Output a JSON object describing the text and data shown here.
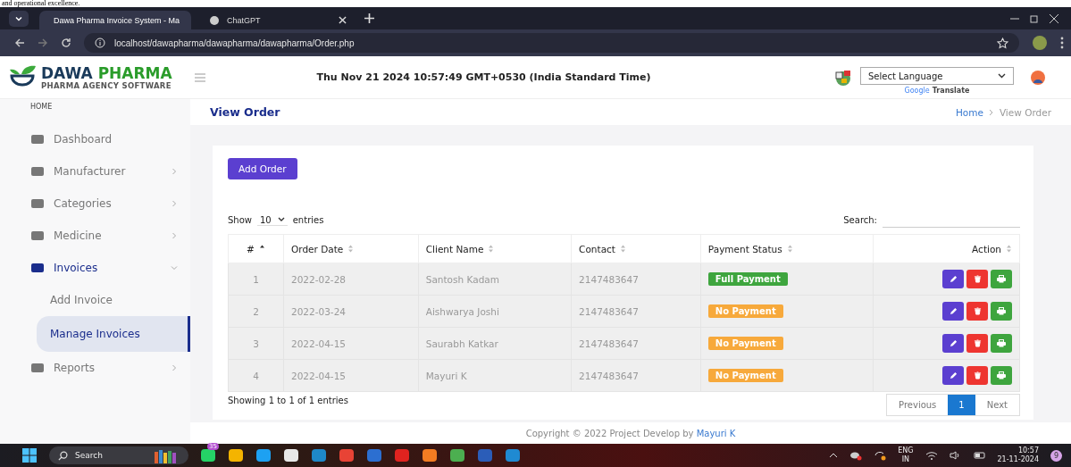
{
  "caption_text": "and operational excellence.",
  "browser": {
    "tabs": [
      {
        "title": "Dawa Pharma Invoice System - Ma",
        "selected": true
      },
      {
        "title": "ChatGPT",
        "selected": false
      }
    ],
    "url": "localhost/dawapharma/dawapharma/dawapharma/Order.php"
  },
  "header": {
    "logo_word_1": "DAWA",
    "logo_word_2": "PHARMA",
    "logo_subtitle": "PHARMA AGENCY SOFTWARE",
    "datetime": "Thu Nov 21 2024 10:57:49 GMT+0530 (India Standard Time)",
    "language_select": "Select Language",
    "translate_brand": "Google",
    "translate_label": "Translate"
  },
  "sidebar": {
    "section": "HOME",
    "items": [
      {
        "label": "Dashboard",
        "kind": "link",
        "active": false
      },
      {
        "label": "Manufacturer",
        "kind": "menu",
        "active": false,
        "expanded": false
      },
      {
        "label": "Categories",
        "kind": "menu",
        "active": false,
        "expanded": false
      },
      {
        "label": "Medicine",
        "kind": "menu",
        "active": false,
        "expanded": false
      },
      {
        "label": "Invoices",
        "kind": "menu",
        "active": true,
        "expanded": true,
        "children": [
          {
            "label": "Add Invoice",
            "selected": false
          },
          {
            "label": "Manage Invoices",
            "selected": true
          }
        ]
      },
      {
        "label": "Reports",
        "kind": "menu",
        "active": false,
        "expanded": false
      }
    ]
  },
  "page": {
    "title": "View Order",
    "breadcrumb": [
      "Home",
      "View Order"
    ],
    "add_button": "Add Order",
    "show_label": "Show",
    "entries_value": "10",
    "entries_label": "entries",
    "search_label": "Search:",
    "columns": [
      {
        "label": "#",
        "sorted": true
      },
      {
        "label": "Order Date",
        "sorted": false
      },
      {
        "label": "Client Name",
        "sorted": false
      },
      {
        "label": "Contact",
        "sorted": false
      },
      {
        "label": "Payment Status",
        "sorted": false
      },
      {
        "label": "Action",
        "sorted": false
      }
    ],
    "rows": [
      {
        "number": "1",
        "date": "2022-02-28",
        "client": "Santosh Kadam",
        "contact": "2147483647",
        "status": {
          "label": "Full Payment",
          "kind": "full"
        }
      },
      {
        "number": "2",
        "date": "2022-03-24",
        "client": "Aishwarya Joshi",
        "contact": "2147483647",
        "status": {
          "label": "No Payment",
          "kind": "none"
        }
      },
      {
        "number": "3",
        "date": "2022-04-15",
        "client": "Saurabh Katkar",
        "contact": "2147483647",
        "status": {
          "label": "No Payment",
          "kind": "none"
        }
      },
      {
        "number": "4",
        "date": "2022-04-15",
        "client": "Mayuri K",
        "contact": "2147483647",
        "status": {
          "label": "No Payment",
          "kind": "none"
        }
      }
    ],
    "info": "Showing 1 to 1 of 1 entries",
    "pagination": {
      "previous": "Previous",
      "pages": [
        {
          "label": "1",
          "selected": true
        }
      ],
      "next": "Next"
    },
    "footer": {
      "text": "Copyright © 2022 Project Develop by",
      "link": "Mayuri K"
    }
  },
  "taskbar": {
    "search": "Search",
    "chat_badge": "35",
    "language": "ENG",
    "region": "IN",
    "time": "10:57",
    "date": "21-11-2024",
    "notification_count": "9"
  }
}
